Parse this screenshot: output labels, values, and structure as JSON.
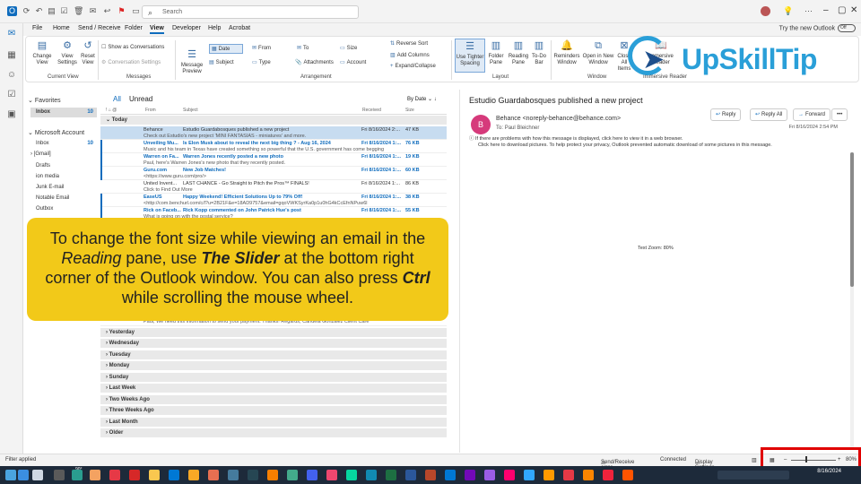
{
  "titlebar": {
    "search_placeholder": "Search"
  },
  "menubar": {
    "items": [
      "File",
      "Home",
      "Send / Receive",
      "Folder",
      "View",
      "Developer",
      "Help",
      "Acrobat"
    ],
    "active": "View",
    "try_new": "Try the new Outlook",
    "toggle": "Off"
  },
  "ribbon": {
    "change_view": "Change View",
    "view_settings": "View Settings",
    "reset_view": "Reset View",
    "current_view": "Current View",
    "show_as_conversations": "Show as Conversations",
    "conversation_settings": "Conversation Settings",
    "messages": "Messages",
    "message_preview": "Message Preview",
    "arr_date": "Date",
    "arr_from": "From",
    "arr_to": "To",
    "arr_size": "Size",
    "arr_subject": "Subject",
    "arr_type": "Type",
    "arr_attachments": "Attachments",
    "arr_account": "Account",
    "reverse_sort": "Reverse Sort",
    "add_columns": "Add Columns",
    "expand_collapse": "Expand/Collapse",
    "arrangement": "Arrangement",
    "use_tighter_spacing": "Use Tighter Spacing",
    "folder_pane": "Folder Pane",
    "reading_pane": "Reading Pane",
    "todo_bar": "To-Do Bar",
    "layout": "Layout",
    "reminders_window": "Reminders Window",
    "open_new_window": "Open in New Window",
    "close_all_items": "Close All Items",
    "window": "Window",
    "immersive_reader": "Immersive Reader",
    "immersive_reader_group": "Immersive Reader"
  },
  "logo": {
    "text": "UpSkillTip"
  },
  "folders": {
    "favorites": "Favorites",
    "fav_inbox": "Inbox",
    "fav_inbox_count": "10",
    "account": "Microsoft Account",
    "items": [
      {
        "label": "Inbox",
        "count": "10"
      },
      {
        "label": "[Gmail]",
        "count": ""
      },
      {
        "label": "Drafts",
        "count": ""
      },
      {
        "label": "ion media",
        "count": ""
      },
      {
        "label": "Junk E-mail",
        "count": ""
      },
      {
        "label": "Notable Email",
        "count": ""
      },
      {
        "label": "Outbox",
        "count": ""
      }
    ]
  },
  "list": {
    "tab_all": "All",
    "tab_unread": "Unread",
    "sort_by": "By Date",
    "col_from": "From",
    "col_subject": "Subject",
    "col_received": "Received",
    "col_size": "Size",
    "group_today": "Today",
    "rows": [
      {
        "from": "Behance",
        "subject": "Estudio Guardabosques published a new project",
        "preview": "Check out Estudio's new project 'MINI FANTASIAS - miniatures' and more.",
        "date": "Fri 8/16/2024 2:...",
        "size": "47 KB"
      },
      {
        "from": "Unveiling Mu...",
        "subject": "Is Elon Musk about to reveal the next big thing ? - Aug 16, 2024",
        "preview": "Music and his team in Texas have created something so powerful that the U.S. government has come begging",
        "date": "Fri 8/16/2024 1:...",
        "size": "76 KB"
      },
      {
        "from": "Warren on Fa...",
        "subject": "Warren Jones recently posted a new photo",
        "preview": "Paul, here's Warren Jones's new photo that they recently posted.",
        "date": "Fri 8/16/2024 1:...",
        "size": "19 KB"
      },
      {
        "from": "Guru.com",
        "subject": "New Job Matches!",
        "preview": "<https://www.guru.com/pro/>",
        "date": "Fri 8/16/2024 1:...",
        "size": "60 KB"
      },
      {
        "from": "United Invent...",
        "subject": "LAST CHANCE - Go Straight to Pitch the Pros™ FINALS!",
        "preview": "Click to Find Out More",
        "date": "Fri 8/16/2024 1:...",
        "size": "86 KB"
      },
      {
        "from": "EaseUS",
        "subject": "Happy Weekend! Efficient Solutions Up to 79% Off!",
        "preview": "<http://com.benchurl.com/c/l?u=2B21F&e=18AD9757&email=gqoVWKSyrKa0p1u0hG4kCcEfnNPuw6l",
        "date": "Fri 8/16/2024 1:...",
        "size": "38 KB"
      },
      {
        "from": "Rick on Faceb...",
        "subject": "Rick Kopp commented on John Patrick Hue's post",
        "preview": "What is going on with the postal service?",
        "date": "Fri 8/16/2024 1:...",
        "size": "55 KB"
      }
    ],
    "hidden_preview": "Paul,  We need this information to send your payment.  Thanks!  Regards,  Candela Gonzalez  Client Care",
    "groups": [
      "Yesterday",
      "Wednesday",
      "Tuesday",
      "Monday",
      "Sunday",
      "Last Week",
      "Two Weeks Ago",
      "Three Weeks Ago",
      "Last Month",
      "Older"
    ]
  },
  "reading": {
    "subject": "Estudio Guardabosques published a new project",
    "avatar": "B",
    "from": "Behance <noreply-behance@behance.com>",
    "to_label": "To",
    "to": "Paul Bleichner",
    "reply": "Reply",
    "reply_all": "Reply All",
    "forward": "Forward",
    "more": "•••",
    "date": "Fri 8/16/2024 2:54 PM",
    "info1": "If there are problems with how this message is displayed, click here to view it in a web browser.",
    "info2": "Click here to download pictures. To help protect your privacy, Outlook prevented automatic download of some pictures in this message.",
    "text_zoom": "Text Zoom: 80%"
  },
  "callout": {
    "p1": "To change the font size while viewing an email in the ",
    "p2": "Reading",
    "p3": " pane, use ",
    "p4": "The Slider",
    "p5": " at the bottom right corner of the Outlook window. You can also press ",
    "p6": "Ctrl",
    "p7": " while scrolling the mouse wheel."
  },
  "status": {
    "filter": "Filter applied",
    "send_receive_error": "Send/Receive error",
    "connected": "Connected",
    "display_settings": "Display Settings",
    "zoom": "80%"
  },
  "taskbar": {
    "temp": "90°",
    "time": "",
    "date": "8/16/2024"
  },
  "colors": {
    "accent": "#0f6cbd",
    "callout": "#f2c919",
    "highlight": "#e00000"
  }
}
